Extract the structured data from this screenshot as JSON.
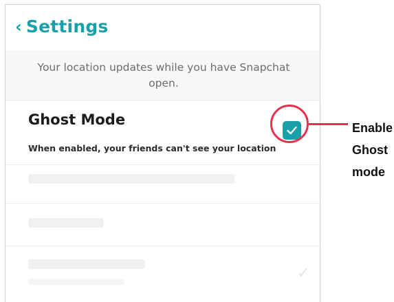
{
  "header": {
    "back_icon": "chevron-left-icon",
    "title": "Settings",
    "accent_color": "#1aa0a8"
  },
  "location_note": "Your location updates while you have Snapchat open.",
  "ghost_mode": {
    "title": "Ghost Mode",
    "description": "When enabled, your friends can't see your location",
    "enabled": true,
    "checkbox_icon": "checkmark-icon"
  },
  "annotation": {
    "highlight_color": "#e8304d",
    "callout_lines": [
      "Enable",
      "Ghost",
      "mode"
    ]
  }
}
